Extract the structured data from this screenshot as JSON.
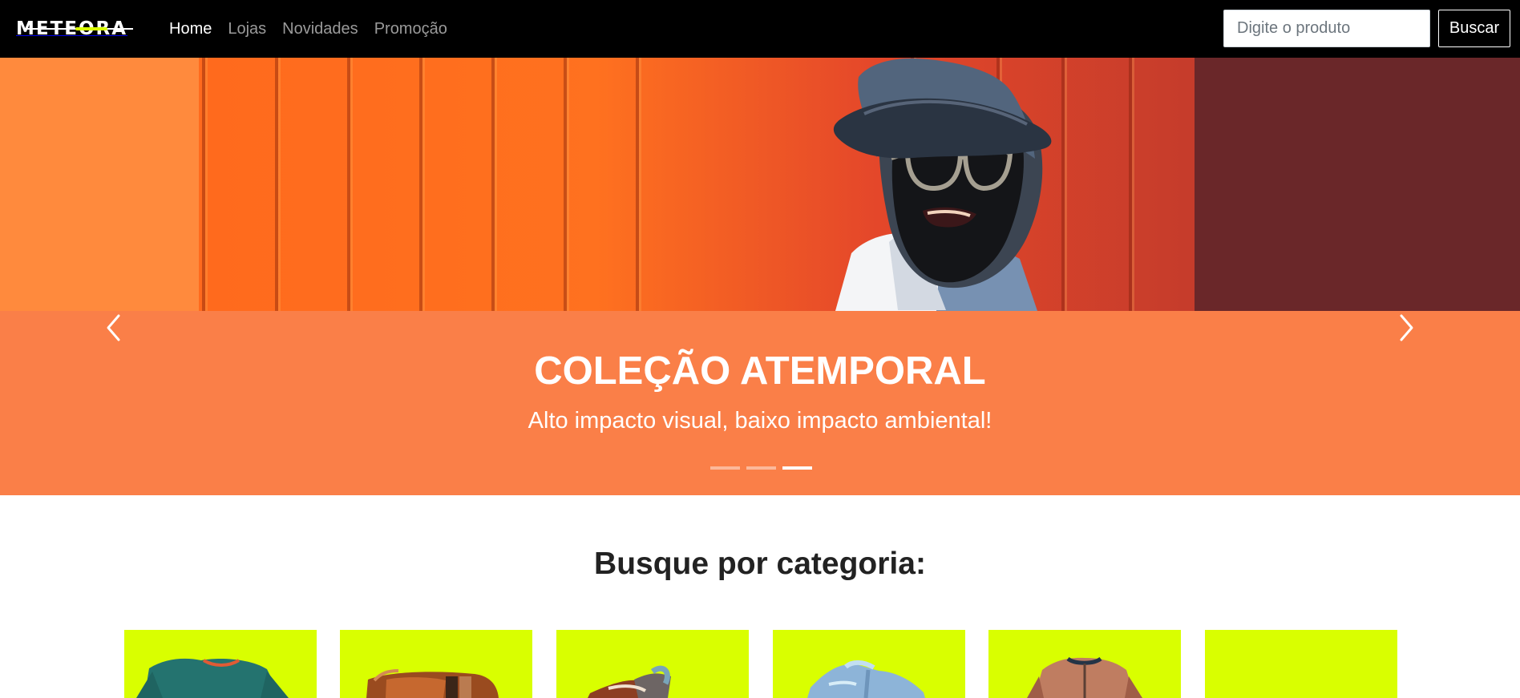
{
  "brand": {
    "logo_text": "METEORA",
    "accent_color": "#d9ff00"
  },
  "nav": {
    "items": [
      {
        "label": "Home",
        "active": true
      },
      {
        "label": "Lojas",
        "active": false
      },
      {
        "label": "Novidades",
        "active": false
      },
      {
        "label": "Promoção",
        "active": false
      }
    ]
  },
  "search": {
    "placeholder": "Digite o produto",
    "button_label": "Buscar"
  },
  "hero": {
    "title": "COLEÇÃO ATEMPORAL",
    "subtitle": "Alto impacto visual, baixo impacto ambiental!",
    "background_color": "#fa7f48",
    "controls": {
      "previous_icon": "chevron-left-icon",
      "next_icon": "chevron-right-icon"
    },
    "slides": {
      "count": 3,
      "active_index": 3
    }
  },
  "categories": {
    "title": "Busque por categoria:",
    "card_color": "#d9ff00",
    "items": [
      {
        "image": "green-t-shirt"
      },
      {
        "image": "brown-leather-bag"
      },
      {
        "image": "shoes"
      },
      {
        "image": "denim-jacket"
      },
      {
        "image": "tan-jacket"
      },
      {
        "image": "empty"
      }
    ]
  }
}
